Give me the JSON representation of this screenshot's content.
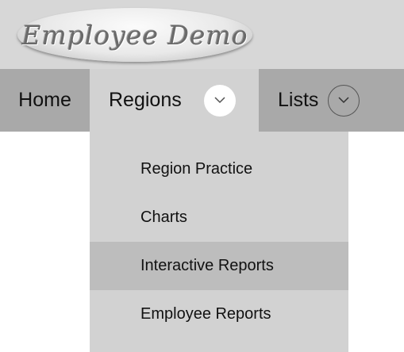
{
  "header": {
    "logo_text": "Employee Demo"
  },
  "nav": {
    "home_label": "Home",
    "regions_label": "Regions",
    "lists_label": "Lists"
  },
  "dropdown": {
    "items": [
      {
        "label": "Region Practice"
      },
      {
        "label": "Charts"
      },
      {
        "label": "Interactive Reports",
        "highlighted": true
      },
      {
        "label": "Employee Reports"
      }
    ]
  },
  "icons": {
    "regions_toggle": "chevron-down-icon",
    "lists_toggle": "chevron-down-icon"
  },
  "colors": {
    "header_bg": "#d7d7d7",
    "nav_bg": "#a9a9a9",
    "active_tab_bg": "#d2d2d2",
    "highlight_bg": "#bdbdbd"
  }
}
